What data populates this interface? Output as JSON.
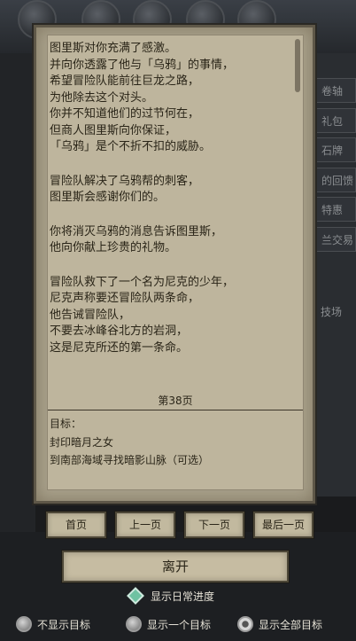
{
  "background_menu": [
    "卷轴",
    "礼包",
    "石牌",
    "的回馈",
    "特惠",
    "兰交易",
    "技场"
  ],
  "story": {
    "paragraphs": [
      [
        "图里斯对你充满了感激。",
        "并向你透露了他与「乌鸦」的事情，",
        "希望冒险队能前往巨龙之路，",
        "为他除去这个对头。",
        "你并不知道他们的过节何在，",
        "但商人图里斯向你保证，",
        "「乌鸦」是个不折不扣的威胁。"
      ],
      [
        "冒险队解决了乌鸦帮的刺客，",
        "图里斯会感谢你们的。"
      ],
      [
        "你将消灭乌鸦的消息告诉图里斯，",
        "他向你献上珍贵的礼物。"
      ],
      [
        "冒险队救下了一个名为尼克的少年，",
        "尼克声称要还冒险队两条命，",
        "他告诫冒险队，",
        "不要去冰峰谷北方的岩洞，",
        "这是尼克所还的第一条命。"
      ]
    ],
    "page": "第38页",
    "goal_title": "目标：",
    "goals": [
      "封印暗月之女",
      "到南部海域寻找暗影山脉（可选）"
    ]
  },
  "nav": {
    "first": "首页",
    "prev": "上一页",
    "next": "下一页",
    "last": "最后一页"
  },
  "leave": "离开",
  "daily_progress": "显示日常进度",
  "radios": [
    {
      "label": "不显示目标",
      "selected": false
    },
    {
      "label": "显示一个目标",
      "selected": false
    },
    {
      "label": "显示全部目标",
      "selected": true
    }
  ],
  "colors": {
    "parchment": "#beb59d",
    "text": "#2a2518",
    "diamond": "#6fc2a2"
  }
}
